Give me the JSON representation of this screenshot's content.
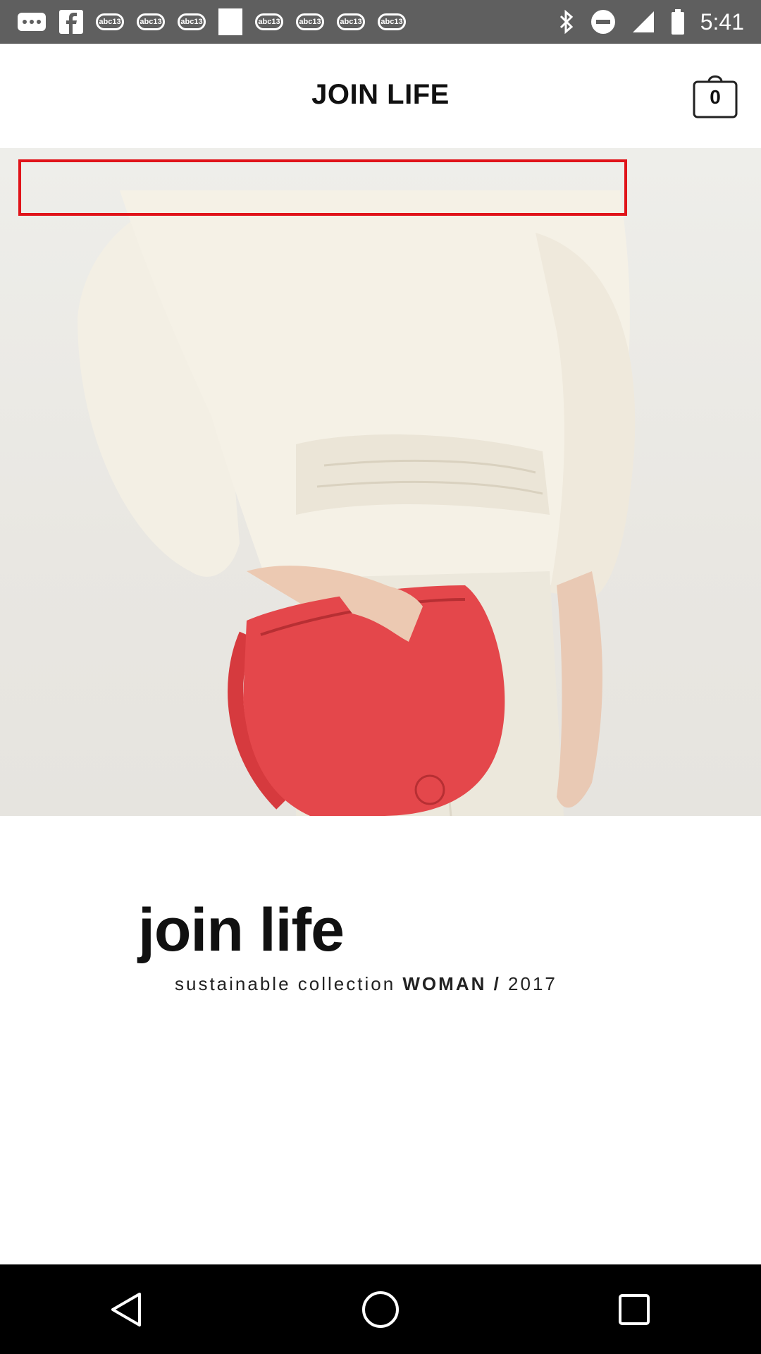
{
  "status_bar": {
    "time": "5:41",
    "notification_icons": [
      "more-icon",
      "facebook-icon",
      "abc13-icon",
      "abc13-icon",
      "abc13-icon",
      "square-icon",
      "abc13-icon",
      "abc13-icon",
      "abc13-icon",
      "abc13-icon"
    ],
    "abc_label": "abc13",
    "system_icons": [
      "bluetooth-icon",
      "do-not-disturb-icon",
      "signal-icon",
      "battery-icon"
    ]
  },
  "header": {
    "title": "JOIN LIFE",
    "bag_count": "0"
  },
  "hero": {
    "image": "woman-white-top-red-bag-photo",
    "highlight_color": "#e0141a"
  },
  "collection": {
    "title": "join life",
    "subtitle_prefix": "sustainable collection",
    "subtitle_strong": "WOMAN /",
    "subtitle_year": "2017"
  },
  "nav_bar": {
    "buttons": [
      "back-icon",
      "home-icon",
      "recents-icon"
    ]
  }
}
